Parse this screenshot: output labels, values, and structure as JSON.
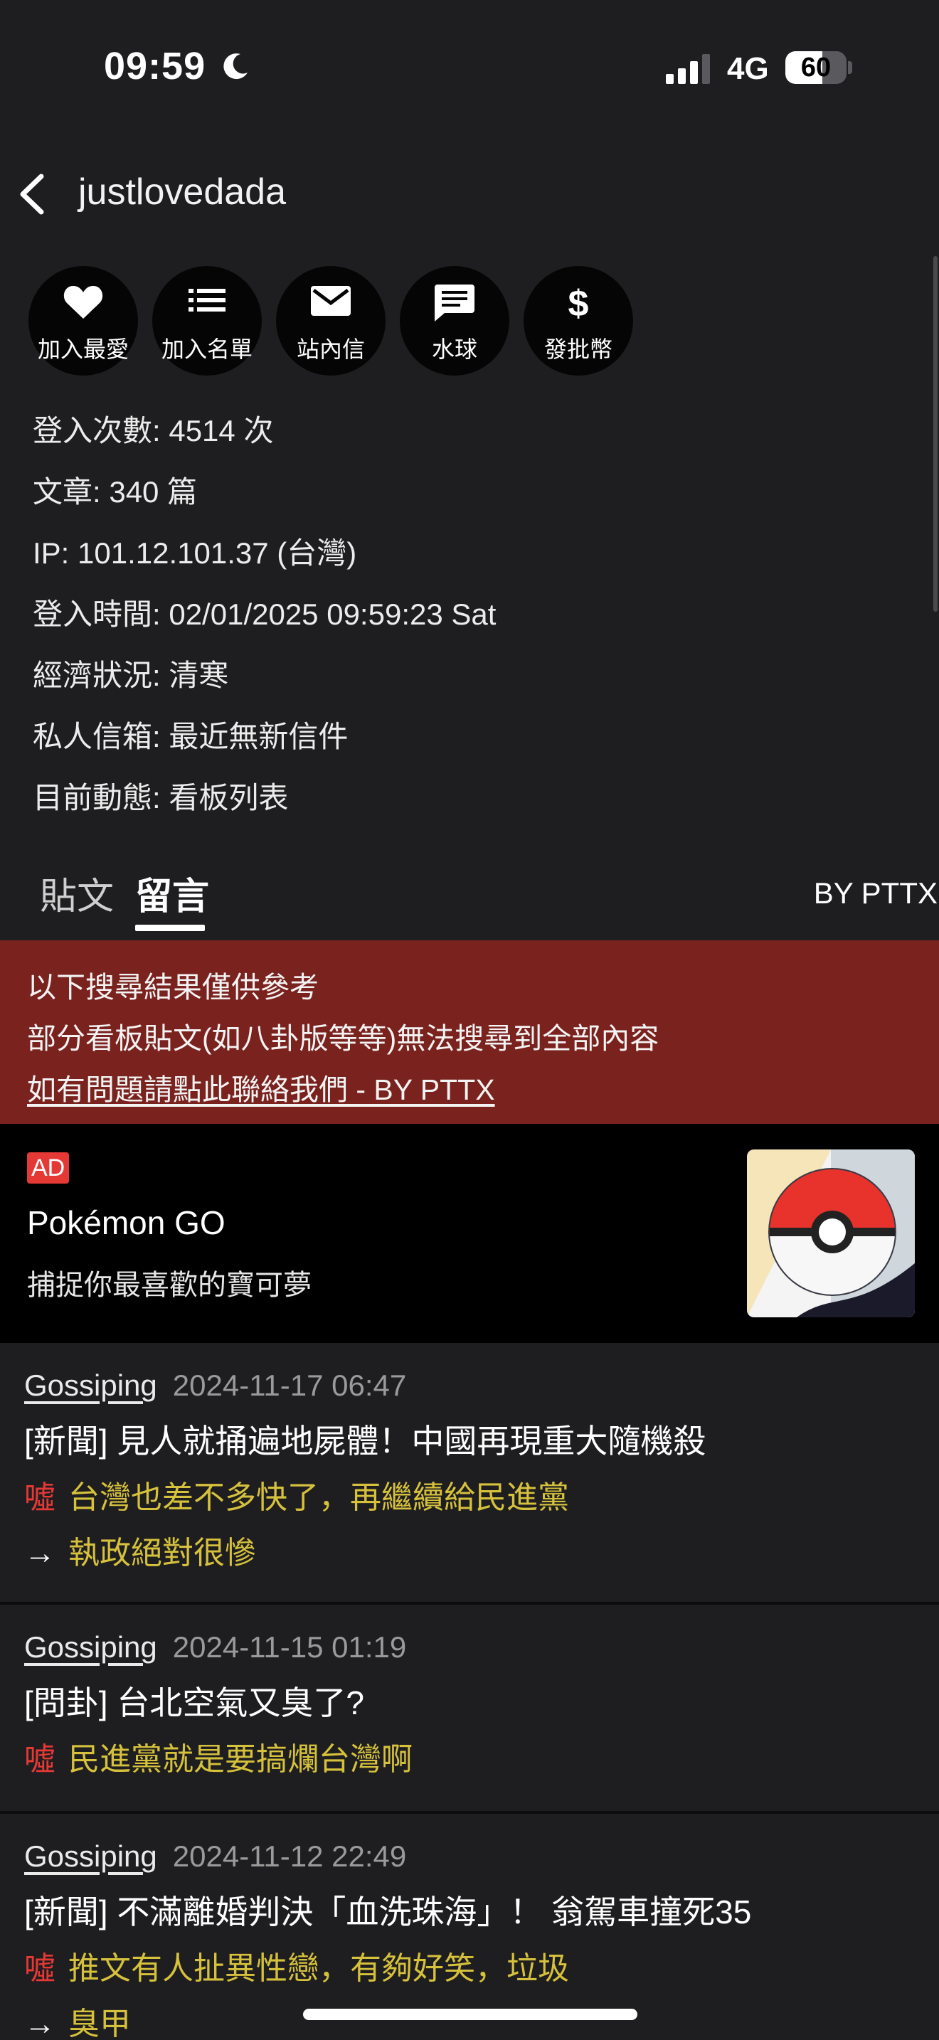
{
  "status_bar": {
    "time": "09:59",
    "network": "4G",
    "battery_level": "60",
    "battery_fraction": 0.6
  },
  "header": {
    "title": "justlovedada"
  },
  "actions": [
    {
      "label": "加入最愛",
      "icon": "heart-icon"
    },
    {
      "label": "加入名單",
      "icon": "list-icon"
    },
    {
      "label": "站內信",
      "icon": "mail-icon"
    },
    {
      "label": "水球",
      "icon": "chat-bubble-icon"
    },
    {
      "label": "發批幣",
      "icon": "dollar-icon"
    }
  ],
  "profile": {
    "rows": [
      "登入次數: 4514 次",
      "文章: 340 篇",
      "IP: 101.12.101.37 (台灣)",
      "登入時間: 02/01/2025 09:59:23 Sat",
      "經濟狀況: 清寒",
      "私人信箱: 最近無新信件",
      "目前動態: 看板列表"
    ]
  },
  "tabs": {
    "posts": "貼文",
    "comments": "留言",
    "active": "comments",
    "byline": "BY PTTX"
  },
  "notice": {
    "line1": "以下搜尋結果僅供參考",
    "line2": "部分看板貼文(如八卦版等等)無法搜尋到全部內容",
    "link": "如有問題請點此聯絡我們 - BY PTTX"
  },
  "ad": {
    "badge": "AD",
    "title": "Pokémon GO",
    "description": "捕捉你最喜歡的寶可夢"
  },
  "comments": [
    {
      "board": "Gossiping",
      "date": "2024-11-17 06:47",
      "title": "[新聞] 見人就捅遍地屍體！中國再現重大隨機殺",
      "lines": [
        {
          "tag": "噓",
          "text": "台灣也差不多快了，再繼續給民進黨"
        },
        {
          "tag": "→",
          "text": "執政絕對很慘"
        }
      ]
    },
    {
      "board": "Gossiping",
      "date": "2024-11-15 01:19",
      "title": "[問卦] 台北空氣又臭了?",
      "lines": [
        {
          "tag": "噓",
          "text": "民進黨就是要搞爛台灣啊"
        }
      ]
    },
    {
      "board": "Gossiping",
      "date": "2024-11-12 22:49",
      "title": "[新聞] 不滿離婚判決「血洗珠海」！ 翁駕車撞死35",
      "lines": [
        {
          "tag": "噓",
          "text": "推文有人扯異性戀，有夠好笑，垃圾"
        },
        {
          "tag": "→",
          "text": "臭甲"
        }
      ]
    }
  ]
}
